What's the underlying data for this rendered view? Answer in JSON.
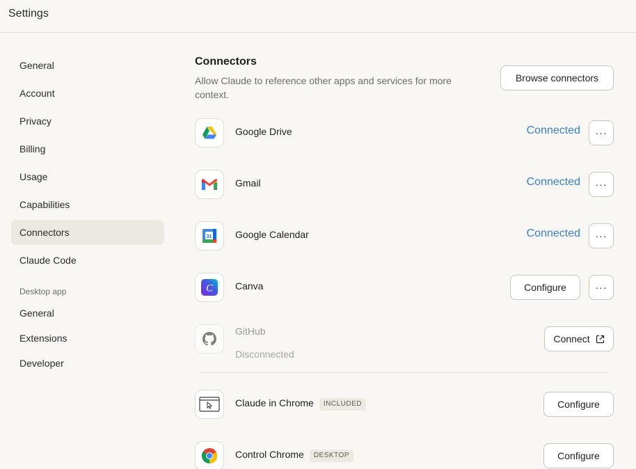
{
  "window": {
    "title": "Settings"
  },
  "sidebar": {
    "items": [
      {
        "label": "General"
      },
      {
        "label": "Account"
      },
      {
        "label": "Privacy"
      },
      {
        "label": "Billing"
      },
      {
        "label": "Usage"
      },
      {
        "label": "Capabilities"
      },
      {
        "label": "Connectors",
        "active": true
      },
      {
        "label": "Claude Code"
      }
    ],
    "desktop_section_label": "Desktop app",
    "desktop_items": [
      {
        "label": "General"
      },
      {
        "label": "Extensions"
      },
      {
        "label": "Developer"
      }
    ]
  },
  "main": {
    "title": "Connectors",
    "description": "Allow Claude to reference other apps and services for more context.",
    "browse_label": "Browse connectors",
    "connectors": [
      {
        "name": "Google Drive",
        "status": "Connected",
        "more_label": "···",
        "icon": "google-drive-icon"
      },
      {
        "name": "Gmail",
        "status": "Connected",
        "more_label": "···",
        "icon": "gmail-icon"
      },
      {
        "name": "Google Calendar",
        "status": "Connected",
        "more_label": "···",
        "icon": "google-calendar-icon",
        "icon_text": "31"
      },
      {
        "name": "Canva",
        "action_label": "Configure",
        "more_label": "···",
        "icon": "canva-icon",
        "icon_text": "C"
      },
      {
        "name": "GitHub",
        "sub": "Disconnected",
        "action_label": "Connect",
        "icon": "github-icon"
      }
    ],
    "extensions": [
      {
        "name": "Claude in Chrome",
        "tag": "INCLUDED",
        "action_label": "Configure",
        "icon": "browser-cursor-icon"
      },
      {
        "name": "Control Chrome",
        "tag": "DESKTOP",
        "action_label": "Configure",
        "icon": "chrome-icon"
      }
    ]
  },
  "colors": {
    "accent_blue": "#3a7fc9",
    "active_bg": "#ece9e2",
    "background": "#f8f7f4"
  }
}
